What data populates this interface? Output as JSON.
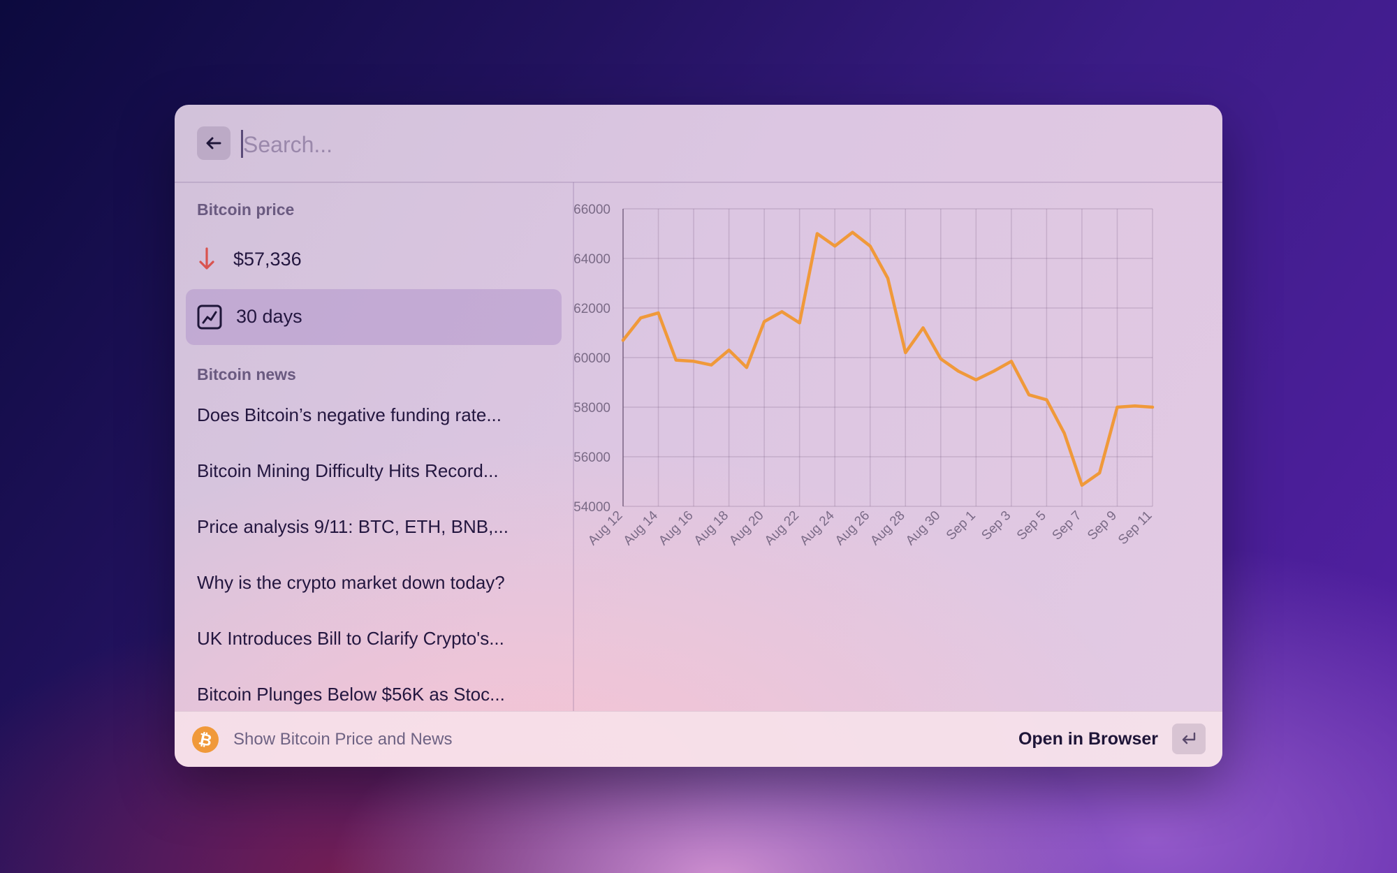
{
  "search": {
    "placeholder": "Search..."
  },
  "icons": {
    "back": "arrow-left-icon",
    "price_change": "arrow-down-icon",
    "chart_toggle": "line-chart-icon",
    "extension": "bitcoin-icon",
    "enter": "return-key-icon"
  },
  "colors": {
    "accent_orange": "#f0993a",
    "down_red": "#d9534f",
    "selected_bg": "#c7b3d6"
  },
  "sidebar": {
    "price_section_label": "Bitcoin price",
    "price_value": "$57,336",
    "chart_item_label": "30 days",
    "news_section_label": "Bitcoin news",
    "news": [
      "Does Bitcoin’s negative funding rate...",
      "Bitcoin Mining Difficulty Hits Record...",
      "Price analysis 9/11: BTC, ETH, BNB,...",
      "Why is the crypto market down today?",
      "UK Introduces Bill to Clarify Crypto's...",
      "Bitcoin Plunges Below $56K as Stoc..."
    ]
  },
  "chart_data": {
    "type": "line",
    "x": [
      "Aug 12",
      "Aug 13",
      "Aug 14",
      "Aug 15",
      "Aug 16",
      "Aug 17",
      "Aug 18",
      "Aug 19",
      "Aug 20",
      "Aug 21",
      "Aug 22",
      "Aug 23",
      "Aug 24",
      "Aug 25",
      "Aug 26",
      "Aug 27",
      "Aug 28",
      "Aug 29",
      "Aug 30",
      "Aug 31",
      "Sep 1",
      "Sep 2",
      "Sep 3",
      "Sep 4",
      "Sep 5",
      "Sep 6",
      "Sep 7",
      "Sep 8",
      "Sep 9",
      "Sep 10",
      "Sep 11"
    ],
    "x_tick_labels": [
      "Aug 12",
      "Aug 14",
      "Aug 16",
      "Aug 18",
      "Aug 20",
      "Aug 22",
      "Aug 24",
      "Aug 26",
      "Aug 28",
      "Aug 30",
      "Sep 1",
      "Sep 3",
      "Sep 5",
      "Sep 7",
      "Sep 9",
      "Sep 11"
    ],
    "series": [
      {
        "color": "#f0993a",
        "values": [
          60700,
          61600,
          61800,
          59900,
          59850,
          59700,
          60300,
          59600,
          61450,
          61850,
          61400,
          65000,
          64500,
          65050,
          64500,
          63200,
          60200,
          61200,
          59950,
          59450,
          59100,
          59450,
          59850,
          58500,
          58300,
          56950,
          54850,
          55350,
          58000,
          58050,
          58000
        ]
      }
    ],
    "ylim": [
      54000,
      66000
    ],
    "y_ticks": [
      54000,
      56000,
      58000,
      60000,
      62000,
      64000,
      66000
    ],
    "grid": true,
    "legend": "none"
  },
  "footer": {
    "title": "Show Bitcoin Price and News",
    "action_label": "Open in Browser"
  }
}
